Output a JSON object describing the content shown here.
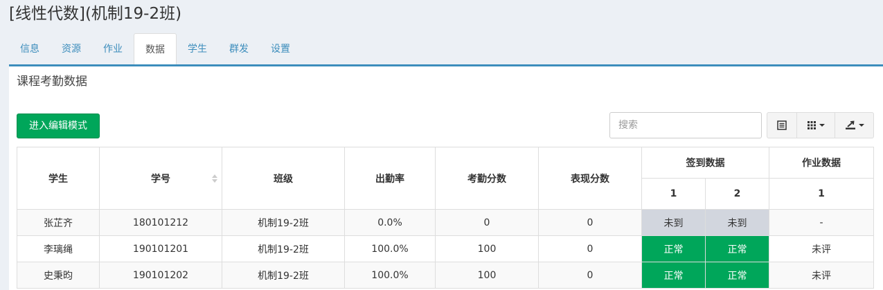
{
  "page": {
    "title": "[线性代数](机制19-2班)"
  },
  "tabs": [
    {
      "label": "信息",
      "active": false
    },
    {
      "label": "资源",
      "active": false
    },
    {
      "label": "作业",
      "active": false
    },
    {
      "label": "数据",
      "active": true
    },
    {
      "label": "学生",
      "active": false
    },
    {
      "label": "群发",
      "active": false
    },
    {
      "label": "设置",
      "active": false
    }
  ],
  "panel": {
    "title": "课程考勤数据"
  },
  "toolbar": {
    "edit_label": "进入编辑模式",
    "search_placeholder": "搜索",
    "buttons": [
      "list-icon",
      "grid-columns-icon",
      "export-icon"
    ]
  },
  "table": {
    "headers": {
      "student": "学生",
      "student_id": "学号",
      "class": "班级",
      "attendance_rate": "出勤率",
      "attendance_score": "考勤分数",
      "performance_score": "表现分数",
      "signin_group": "签到数据",
      "homework_group": "作业数据",
      "signin_cols": [
        "1",
        "2"
      ],
      "homework_cols": [
        "1"
      ]
    },
    "rows": [
      {
        "student": "张芷齐",
        "student_id": "180101212",
        "class": "机制19-2班",
        "attendance_rate": "0.0%",
        "attendance_score": "0",
        "performance_score": "0",
        "signin": [
          "未到",
          "未到"
        ],
        "signin_status": [
          "absent",
          "absent"
        ],
        "homework": [
          "-"
        ]
      },
      {
        "student": "李璃绳",
        "student_id": "190101201",
        "class": "机制19-2班",
        "attendance_rate": "100.0%",
        "attendance_score": "100",
        "performance_score": "0",
        "signin": [
          "正常",
          "正常"
        ],
        "signin_status": [
          "normal",
          "normal"
        ],
        "homework": [
          "未评"
        ]
      },
      {
        "student": "史秉昀",
        "student_id": "190101202",
        "class": "机制19-2班",
        "attendance_rate": "100.0%",
        "attendance_score": "100",
        "performance_score": "0",
        "signin": [
          "正常",
          "正常"
        ],
        "signin_status": [
          "normal",
          "normal"
        ],
        "homework": [
          "未评"
        ]
      }
    ]
  },
  "colors": {
    "primary": "#3c8dbc",
    "success": "#00a65a",
    "absent": "#d2d6de"
  }
}
